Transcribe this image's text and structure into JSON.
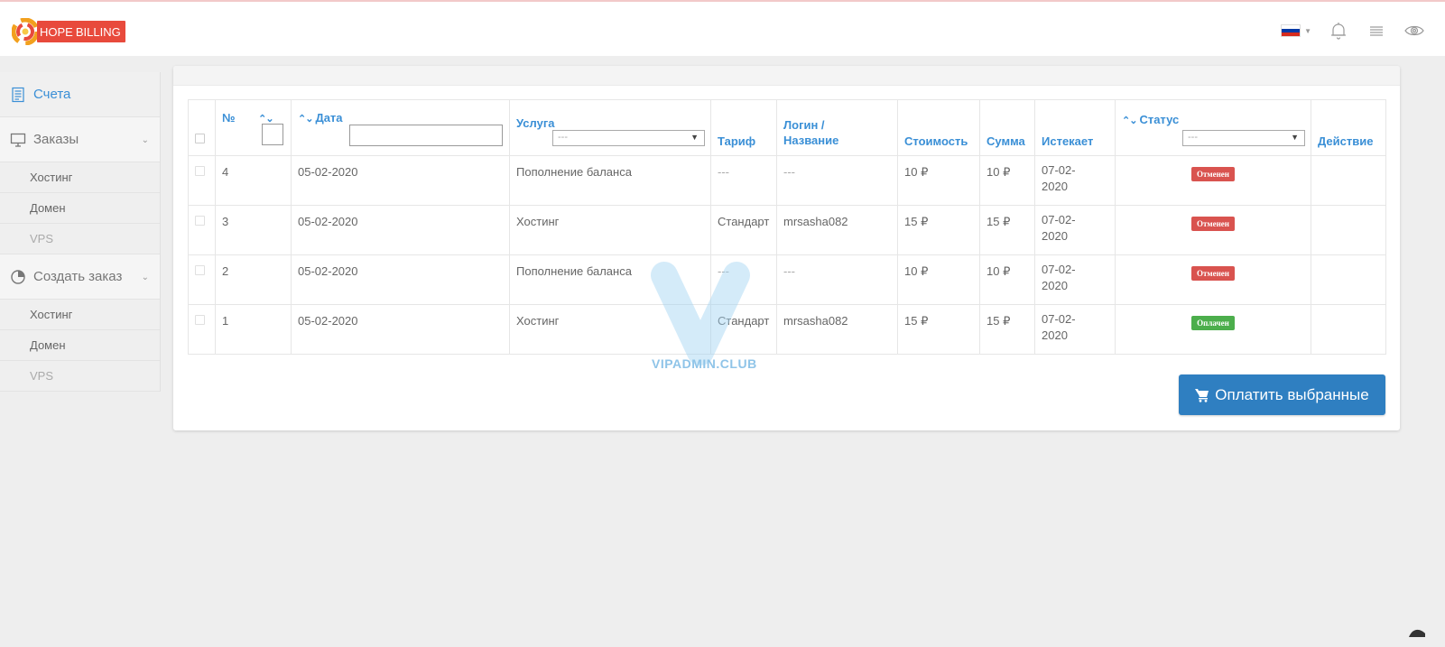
{
  "brand": {
    "hope": "HOPE",
    "billing": "BILLING"
  },
  "topbar": {
    "flag_colors": [
      "#ffffff",
      "#0039a6",
      "#d52b1e"
    ]
  },
  "sidebar": {
    "items": [
      {
        "label": "Счета",
        "icon": "invoice-icon",
        "active": true
      },
      {
        "label": "Заказы",
        "icon": "monitor-icon",
        "sub": [
          "Хостинг",
          "Домен",
          "VPS"
        ]
      },
      {
        "label": "Создать заказ",
        "icon": "pie-chart-icon",
        "sub": [
          "Хостинг",
          "Домен",
          "VPS"
        ]
      }
    ]
  },
  "table": {
    "headers": {
      "num": "№",
      "date": "Дата",
      "service": "Услуга",
      "tariff": "Тариф",
      "login_line1": "Логин /",
      "login_line2": "Название",
      "cost": "Стоимость",
      "sum": "Сумма",
      "expires": "Истекает",
      "status": "Статус",
      "action": "Действие"
    },
    "filters": {
      "service": "---",
      "status": "---"
    },
    "rows": [
      {
        "num": "4",
        "date": "05-02-2020",
        "service": "Пополнение баланса",
        "tariff": "---",
        "login": "---",
        "cost": "10 ₽",
        "sum": "10 ₽",
        "exp1": "07-02-",
        "exp2": "2020",
        "status": "Отменен",
        "status_color": "#d9534f"
      },
      {
        "num": "3",
        "date": "05-02-2020",
        "service": "Хостинг",
        "tariff": "Стандарт",
        "login": "mrsasha082",
        "cost": "15 ₽",
        "sum": "15 ₽",
        "exp1": "07-02-",
        "exp2": "2020",
        "status": "Отменен",
        "status_color": "#d9534f"
      },
      {
        "num": "2",
        "date": "05-02-2020",
        "service": "Пополнение баланса",
        "tariff": "---",
        "login": "---",
        "cost": "10 ₽",
        "sum": "10 ₽",
        "exp1": "07-02-",
        "exp2": "2020",
        "status": "Отменен",
        "status_color": "#d9534f"
      },
      {
        "num": "1",
        "date": "05-02-2020",
        "service": "Хостинг",
        "tariff": "Стандарт",
        "login": "mrsasha082",
        "cost": "15 ₽",
        "sum": "15 ₽",
        "exp1": "07-02-",
        "exp2": "2020",
        "status": "Оплачен",
        "status_color": "#4cae4c"
      }
    ]
  },
  "pay_button": {
    "label": "Оплатить выбранные",
    "color": "#2f7fc1"
  },
  "watermark": {
    "text": "VIPADMIN.CLUB"
  }
}
